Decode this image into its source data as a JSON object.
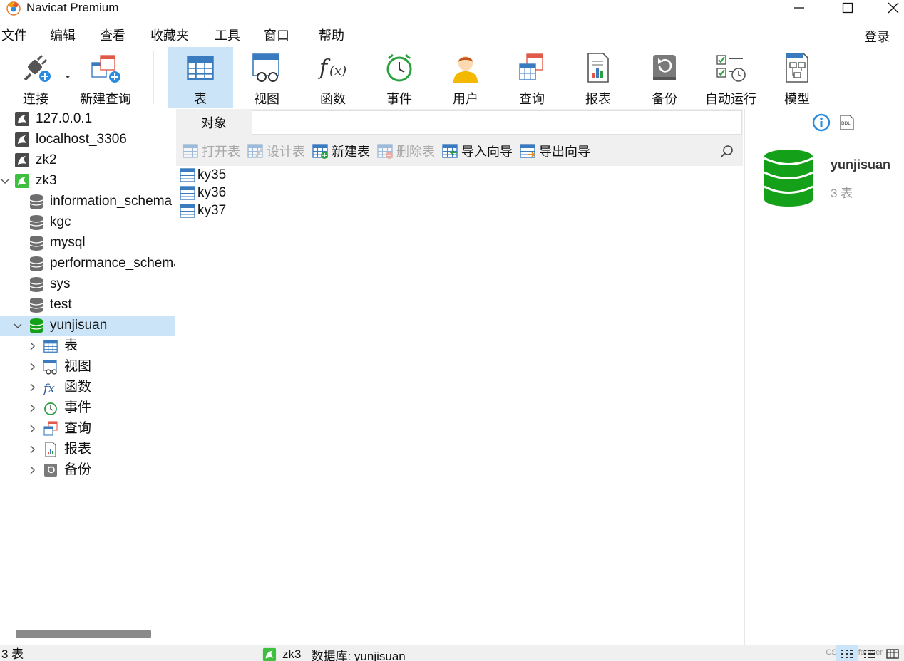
{
  "window": {
    "title": "Navicat Premium"
  },
  "menu": [
    "文件",
    "编辑",
    "查看",
    "收藏夹",
    "工具",
    "窗口",
    "帮助"
  ],
  "login_label": "登录",
  "toolbar": {
    "connect": "连接",
    "new_query": "新建查询",
    "table": "表",
    "view": "视图",
    "function": "函数",
    "event": "事件",
    "user": "用户",
    "query": "查询",
    "report": "报表",
    "backup": "备份",
    "automation": "自动运行",
    "model": "模型"
  },
  "tree": {
    "connections": [
      "127.0.0.1",
      "localhost_3306",
      "zk2",
      "zk3"
    ],
    "databases": [
      "information_schema",
      "kgc",
      "mysql",
      "performance_schema",
      "sys",
      "test",
      "yunjisuan"
    ],
    "categories": [
      "表",
      "视图",
      "函数",
      "事件",
      "查询",
      "报表",
      "备份"
    ]
  },
  "tabs": {
    "object": "对象"
  },
  "actions": {
    "open_table": "打开表",
    "design_table": "设计表",
    "new_table": "新建表",
    "delete_table": "删除表",
    "import_wizard": "导入向导",
    "export_wizard": "导出向导"
  },
  "objects": [
    "ky35",
    "ky36",
    "ky37"
  ],
  "details": {
    "name": "yunjisuan",
    "count": "3 表"
  },
  "status": {
    "count": "3 表",
    "connection": "zk3",
    "database": "数据库: yunjisuan",
    "watermark": "CSDN @forever"
  },
  "colors": {
    "accent": "#cce4f7",
    "db_green": "#14a019",
    "table_blue": "#3a7bbf"
  }
}
